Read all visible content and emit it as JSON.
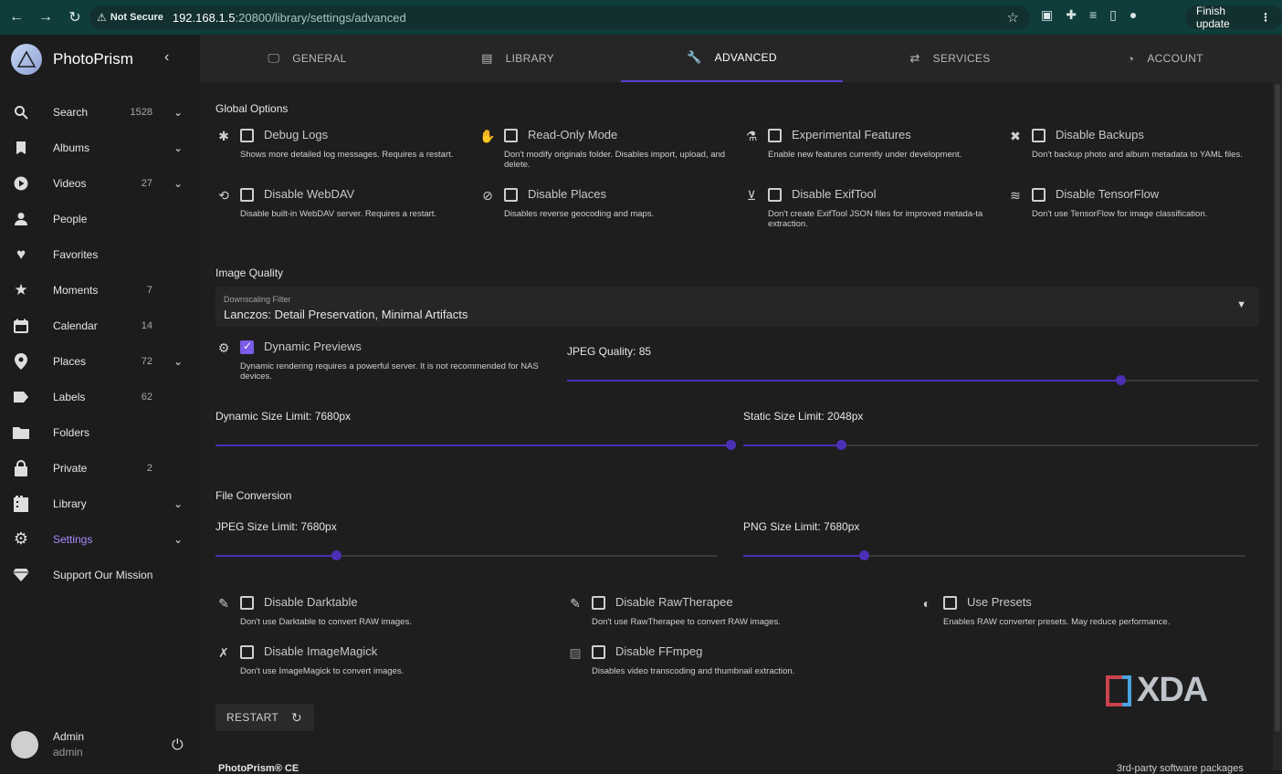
{
  "browser": {
    "not_secure": "Not Secure",
    "url_host": "192.168.1.5",
    "url_rest": ":20800/library/settings/advanced",
    "finish_update": "Finish update"
  },
  "sidebar": {
    "brand": "PhotoPrism",
    "items": [
      {
        "label": "Search",
        "count": "1528",
        "icon": "search-icon"
      },
      {
        "label": "Albums",
        "count": "",
        "icon": "bookmark-icon"
      },
      {
        "label": "Videos",
        "count": "27",
        "icon": "play-icon"
      },
      {
        "label": "People",
        "count": "",
        "icon": "person-icon"
      },
      {
        "label": "Favorites",
        "count": "",
        "icon": "heart-icon"
      },
      {
        "label": "Moments",
        "count": "7",
        "icon": "star-icon"
      },
      {
        "label": "Calendar",
        "count": "14",
        "icon": "calendar-icon"
      },
      {
        "label": "Places",
        "count": "72",
        "icon": "pin-icon"
      },
      {
        "label": "Labels",
        "count": "62",
        "icon": "label-icon"
      },
      {
        "label": "Folders",
        "count": "",
        "icon": "folder-icon"
      },
      {
        "label": "Private",
        "count": "2",
        "icon": "lock-icon"
      },
      {
        "label": "Library",
        "count": "",
        "icon": "film-icon"
      },
      {
        "label": "Settings",
        "count": "",
        "icon": "gear-icon"
      },
      {
        "label": "Support Our Mission",
        "count": "",
        "icon": "gem-icon"
      }
    ],
    "user_name": "Admin",
    "user_login": "admin"
  },
  "tabs": [
    {
      "label": "GENERAL",
      "icon": "monitor-icon"
    },
    {
      "label": "LIBRARY",
      "icon": "film-icon"
    },
    {
      "label": "ADVANCED",
      "icon": "wrench-icon"
    },
    {
      "label": "SERVICES",
      "icon": "swap-icon"
    },
    {
      "label": "ACCOUNT",
      "icon": "account-icon"
    }
  ],
  "global": {
    "title": "Global Options",
    "options": [
      {
        "label": "Debug Logs",
        "desc": "Shows more detailed log messages. Requires a restart."
      },
      {
        "label": "Read-Only Mode",
        "desc": "Don't modify originals folder. Disables import, upload, and delete."
      },
      {
        "label": "Experimental Features",
        "desc": "Enable new features currently under development."
      },
      {
        "label": "Disable Backups",
        "desc": "Don't backup photo and album metadata to YAML files."
      },
      {
        "label": "Disable WebDAV",
        "desc": "Disable built-in WebDAV server. Requires a restart."
      },
      {
        "label": "Disable Places",
        "desc": "Disables reverse geocoding and maps."
      },
      {
        "label": "Disable ExifTool",
        "desc": "Don't create ExifTool JSON files for improved metada-ta extraction."
      },
      {
        "label": "Disable TensorFlow",
        "desc": "Don't use TensorFlow for image classification."
      }
    ]
  },
  "image_quality": {
    "title": "Image Quality",
    "filter_label": "Downscaling Filter",
    "filter_value": "Lanczos: Detail Preservation, Minimal Artifacts",
    "dynamic_previews": {
      "label": "Dynamic Previews",
      "desc": "Dynamic rendering requires a powerful server. It is not recommended for NAS devices."
    },
    "jpeg_quality": {
      "label": "JPEG Quality: 85",
      "fraction": 0.8
    },
    "dynamic_size": {
      "label": "Dynamic Size Limit: 7680px",
      "fraction": 1.0
    },
    "static_size": {
      "label": "Static Size Limit: 2048px",
      "fraction": 0.19
    }
  },
  "file_conversion": {
    "title": "File Conversion",
    "jpeg_size": {
      "label": "JPEG Size Limit: 7680px",
      "fraction": 0.24
    },
    "png_size": {
      "label": "PNG Size Limit: 7680px",
      "fraction": 0.24
    },
    "options": [
      {
        "label": "Disable Darktable",
        "desc": "Don't use Darktable to convert RAW images."
      },
      {
        "label": "Disable RawTherapee",
        "desc": "Don't use RawTherapee to convert RAW images."
      },
      {
        "label": "Use Presets",
        "desc": "Enables RAW converter presets. May reduce performance."
      },
      {
        "label": "Disable ImageMagick",
        "desc": "Don't use ImageMagick to convert images."
      },
      {
        "label": "Disable FFmpeg",
        "desc": "Disables video transcoding and thumbnail extraction."
      }
    ]
  },
  "restart_label": "RESTART",
  "watermark": "XDA",
  "footer_left": "PhotoPrism® CE",
  "footer_right": "3rd-party software packages"
}
